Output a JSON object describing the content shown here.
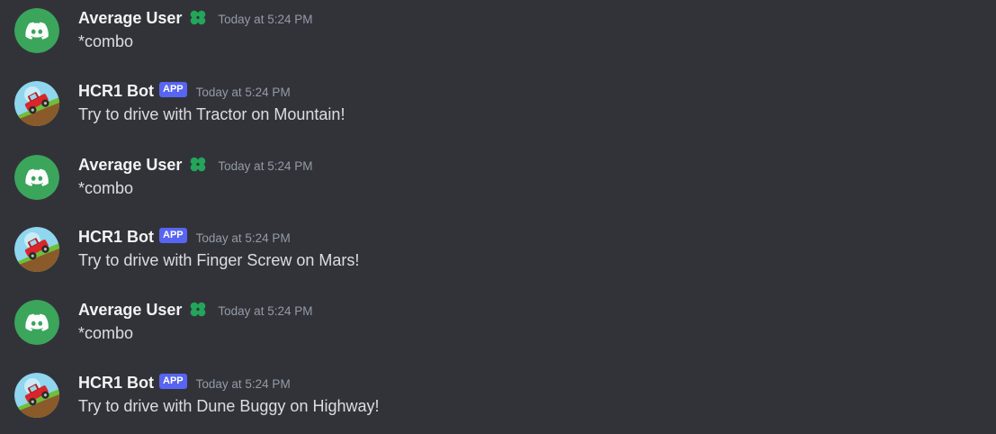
{
  "colors": {
    "background": "#323339",
    "discord_avatar": "#3ba55c",
    "app_badge": "#5865f2",
    "timestamp": "#949ba4",
    "username": "#f2f3f5",
    "message_text": "#dbdee1",
    "user_badge_icon": "#23a55a"
  },
  "messages": [
    {
      "author": "Average User",
      "avatar": "discord-logo-icon",
      "badge_icon": "clover-icon",
      "app_tag": "",
      "timestamp": "Today at 5:24 PM",
      "content": "*combo"
    },
    {
      "author": "HCR1 Bot",
      "avatar": "red-jeep-climbing-hill-icon",
      "badge_icon": "",
      "app_tag": "APP",
      "timestamp": "Today at 5:24 PM",
      "content": "Try to drive with Tractor on Mountain!"
    },
    {
      "author": "Average User",
      "avatar": "discord-logo-icon",
      "badge_icon": "clover-icon",
      "app_tag": "",
      "timestamp": "Today at 5:24 PM",
      "content": "*combo"
    },
    {
      "author": "HCR1 Bot",
      "avatar": "red-jeep-climbing-hill-icon",
      "badge_icon": "",
      "app_tag": "APP",
      "timestamp": "Today at 5:24 PM",
      "content": "Try to drive with Finger Screw on Mars!"
    },
    {
      "author": "Average User",
      "avatar": "discord-logo-icon",
      "badge_icon": "clover-icon",
      "app_tag": "",
      "timestamp": "Today at 5:24 PM",
      "content": "*combo"
    },
    {
      "author": "HCR1 Bot",
      "avatar": "red-jeep-climbing-hill-icon",
      "badge_icon": "",
      "app_tag": "APP",
      "timestamp": "Today at 5:24 PM",
      "content": "Try to drive with Dune Buggy on Highway!"
    }
  ]
}
